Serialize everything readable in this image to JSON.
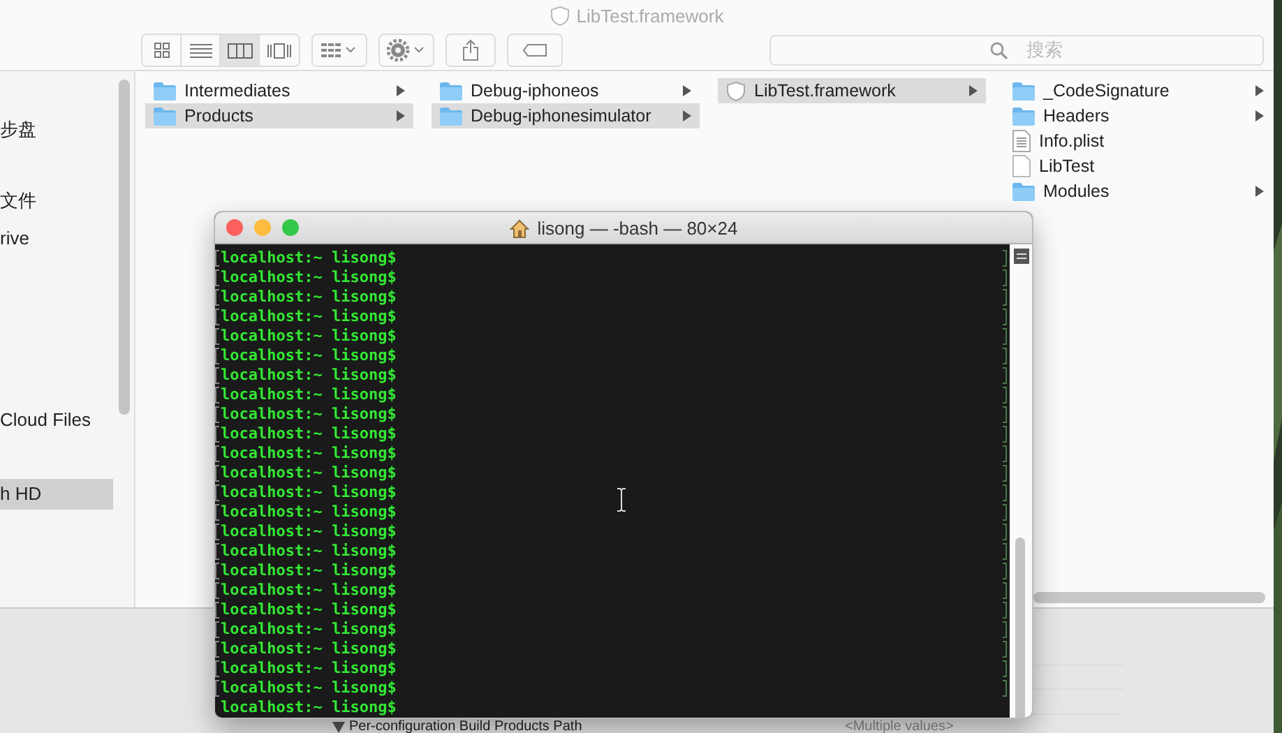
{
  "finder": {
    "title": "LibTest.framework",
    "search": {
      "placeholder": "搜索"
    },
    "toolbar": [
      {
        "kind": "view-group"
      },
      {
        "kind": "arrange"
      },
      {
        "kind": "action"
      },
      {
        "kind": "share"
      },
      {
        "kind": "tag"
      }
    ],
    "sidebar": [
      {
        "label": "步盘",
        "selected": false
      },
      {
        "label": "文件",
        "selected": false
      },
      {
        "label": "rive",
        "selected": false
      },
      {
        "label": "Cloud Files",
        "selected": false
      },
      {
        "label": "h HD",
        "selected": true
      }
    ],
    "columns": [
      {
        "items": [
          {
            "name": "Intermediates",
            "kind": "folder",
            "selected": false,
            "has_children": true
          },
          {
            "name": "Products",
            "kind": "folder",
            "selected": true,
            "has_children": true
          }
        ]
      },
      {
        "items": [
          {
            "name": "Debug-iphoneos",
            "kind": "folder",
            "selected": false,
            "has_children": true
          },
          {
            "name": "Debug-iphonesimulator",
            "kind": "folder",
            "selected": true,
            "has_children": true
          }
        ]
      },
      {
        "items": [
          {
            "name": "LibTest.framework",
            "kind": "bundle",
            "selected": true,
            "has_children": true
          }
        ]
      },
      {
        "items": [
          {
            "name": "_CodeSignature",
            "kind": "folder",
            "selected": false,
            "has_children": true
          },
          {
            "name": "Headers",
            "kind": "folder",
            "selected": false,
            "has_children": true
          },
          {
            "name": "Info.plist",
            "kind": "plist",
            "selected": false,
            "has_children": false
          },
          {
            "name": "LibTest",
            "kind": "file",
            "selected": false,
            "has_children": false
          },
          {
            "name": "Modules",
            "kind": "folder",
            "selected": false,
            "has_children": true
          }
        ]
      }
    ]
  },
  "terminal": {
    "title": "lisong — -bash — 80×24",
    "lines": [
      {
        "text": "localhost:~ lisong$",
        "marked": true
      },
      {
        "text": "localhost:~ lisong$",
        "marked": true
      },
      {
        "text": "localhost:~ lisong$",
        "marked": true
      },
      {
        "text": "localhost:~ lisong$",
        "marked": true
      },
      {
        "text": "localhost:~ lisong$",
        "marked": true
      },
      {
        "text": "localhost:~ lisong$",
        "marked": true
      },
      {
        "text": "localhost:~ lisong$",
        "marked": true
      },
      {
        "text": "localhost:~ lisong$",
        "marked": true
      },
      {
        "text": "localhost:~ lisong$",
        "marked": true
      },
      {
        "text": "localhost:~ lisong$",
        "marked": true
      },
      {
        "text": "localhost:~ lisong$",
        "marked": true
      },
      {
        "text": "localhost:~ lisong$",
        "marked": true
      },
      {
        "text": "localhost:~ lisong$",
        "marked": true
      },
      {
        "text": "localhost:~ lisong$",
        "marked": true
      },
      {
        "text": "localhost:~ lisong$",
        "marked": true
      },
      {
        "text": "localhost:~ lisong$",
        "marked": true
      },
      {
        "text": "localhost:~ lisong$",
        "marked": true
      },
      {
        "text": "localhost:~ lisong$",
        "marked": true
      },
      {
        "text": "localhost:~ lisong$",
        "marked": true
      },
      {
        "text": "localhost:~ lisong$",
        "marked": true
      },
      {
        "text": "localhost:~ lisong$",
        "marked": true
      },
      {
        "text": "localhost:~ lisong$",
        "marked": true
      },
      {
        "text": "localhost:~ lisong$",
        "marked": true
      },
      {
        "text": "localhost:~ lisong$",
        "marked": false
      }
    ]
  },
  "xcode": {
    "setting": "Per-configuration Build Products Path",
    "value": "<Multiple values>"
  }
}
